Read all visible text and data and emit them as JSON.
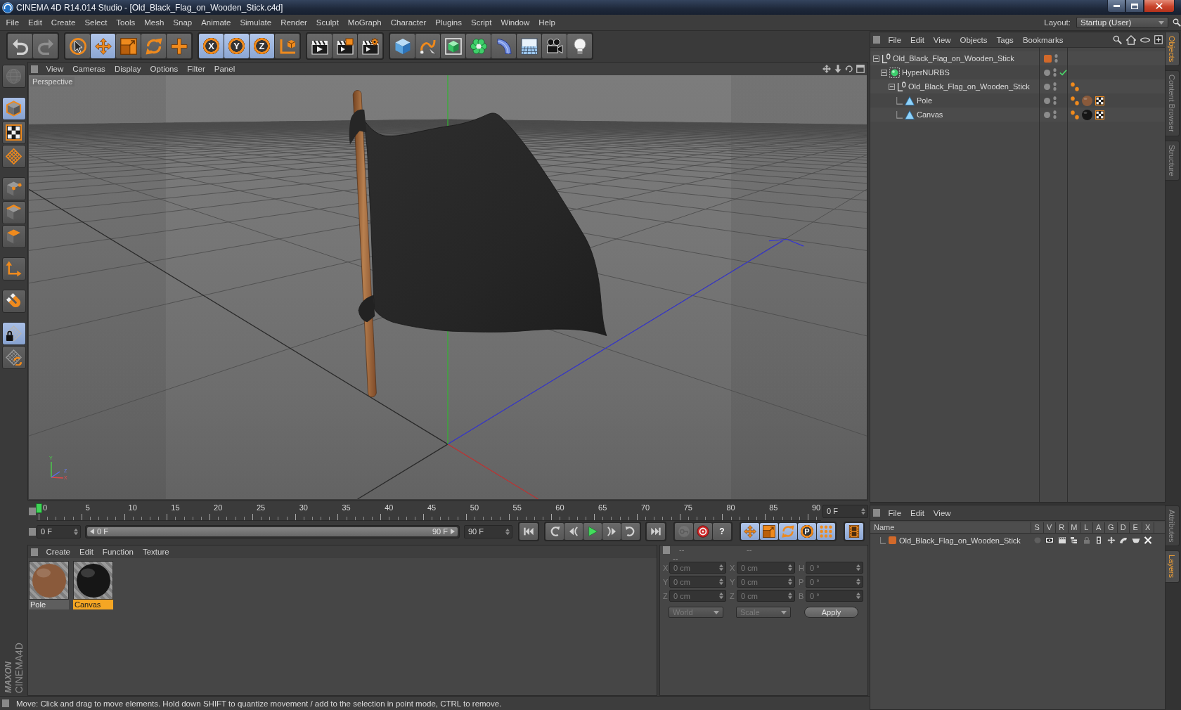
{
  "window": {
    "title": "CINEMA 4D R14.014 Studio - [Old_Black_Flag_on_Wooden_Stick.c4d]"
  },
  "menu": [
    "File",
    "Edit",
    "Create",
    "Select",
    "Tools",
    "Mesh",
    "Snap",
    "Animate",
    "Simulate",
    "Render",
    "Sculpt",
    "MoGraph",
    "Character",
    "Plugins",
    "Script",
    "Window",
    "Help"
  ],
  "layout": {
    "label": "Layout:",
    "value": "Startup (User)"
  },
  "toolbar": [
    {
      "items": [
        {
          "kind": "undo",
          "disabled": false
        },
        {
          "kind": "redo",
          "disabled": true
        }
      ]
    },
    {
      "items": [
        {
          "kind": "select",
          "selected": false
        },
        {
          "kind": "move",
          "selected": true
        },
        {
          "kind": "scale",
          "selected": false
        },
        {
          "kind": "rotate",
          "selected": false
        },
        {
          "kind": "recent",
          "selected": false
        }
      ]
    },
    {
      "items": [
        {
          "kind": "axis",
          "label": "X",
          "selected": true
        },
        {
          "kind": "axis",
          "label": "Y",
          "selected": true
        },
        {
          "kind": "axis",
          "label": "Z",
          "selected": true
        },
        {
          "kind": "coords",
          "selected": false
        }
      ]
    },
    {
      "items": [
        {
          "kind": "renderview"
        },
        {
          "kind": "renderpicture"
        },
        {
          "kind": "rendersettings"
        }
      ]
    },
    {
      "items": [
        {
          "kind": "cube"
        },
        {
          "kind": "pen"
        },
        {
          "kind": "subdivision"
        },
        {
          "kind": "cloner"
        },
        {
          "kind": "deformer"
        },
        {
          "kind": "floor"
        },
        {
          "kind": "camera"
        },
        {
          "kind": "light"
        }
      ]
    }
  ],
  "modes": [
    {
      "items": [
        {
          "kind": "editable",
          "selected": false,
          "disabled": true
        }
      ]
    },
    {
      "items": [
        {
          "kind": "model",
          "selected": true,
          "disabled": false
        },
        {
          "kind": "texture",
          "selected": false,
          "disabled": false
        },
        {
          "kind": "workplane",
          "selected": false,
          "disabled": false
        }
      ]
    },
    {
      "items": [
        {
          "kind": "points",
          "selected": false,
          "disabled": false
        },
        {
          "kind": "edges",
          "selected": false,
          "disabled": false
        },
        {
          "kind": "polygons",
          "selected": false,
          "disabled": false
        }
      ]
    },
    {
      "items": [
        {
          "kind": "objectaxis",
          "selected": false,
          "disabled": false
        }
      ]
    },
    {
      "items": [
        {
          "kind": "snap",
          "selected": false,
          "disabled": false
        }
      ]
    },
    {
      "items": [
        {
          "kind": "lockplane",
          "selected": true,
          "disabled": false
        },
        {
          "kind": "planeupdate",
          "selected": false,
          "disabled": false
        }
      ]
    }
  ],
  "logo": {
    "brand": "MAXON",
    "product": "CINEMA4D"
  },
  "viewport": {
    "menu": [
      "View",
      "Cameras",
      "Display",
      "Options",
      "Filter",
      "Panel"
    ],
    "camera": "Perspective",
    "axes": [
      "Y",
      "Z",
      "X"
    ]
  },
  "timeline": {
    "labels": [
      "0",
      "5",
      "10",
      "15",
      "20",
      "25",
      "30",
      "35",
      "40",
      "45",
      "50",
      "55",
      "60",
      "65",
      "70",
      "75",
      "80",
      "85",
      "90"
    ],
    "level": 0,
    "frame": "0 F"
  },
  "transport": {
    "start": "0 F",
    "range": {
      "start": "0 F",
      "end": "90 F",
      "level": 1
    },
    "end": "90 F",
    "playback": [
      [
        {
          "kind": "first"
        }
      ],
      [
        {
          "kind": "prevkey"
        },
        {
          "kind": "prevframe"
        },
        {
          "kind": "play"
        },
        {
          "kind": "nextframe"
        },
        {
          "kind": "nextkey"
        }
      ],
      [
        {
          "kind": "last"
        }
      ]
    ],
    "record": [
      {
        "kind": "keyframe",
        "disabled": true
      },
      {
        "kind": "autokey",
        "disabled": false
      },
      {
        "kind": "keyselect",
        "label": "?",
        "disabled": false
      }
    ],
    "tracks": [
      {
        "kind": "move",
        "selected": true
      },
      {
        "kind": "scale",
        "selected": true
      },
      {
        "kind": "rotate",
        "selected": true
      },
      {
        "kind": "param",
        "label": "P",
        "selected": true
      },
      {
        "kind": "points",
        "selected": true
      }
    ],
    "film": {
      "kind": "film",
      "selected": true
    }
  },
  "materials": {
    "menu": [
      "Create",
      "Edit",
      "Function",
      "Texture"
    ],
    "items": [
      {
        "name": "Pole",
        "color": "#8a5a3b",
        "selected": false
      },
      {
        "name": "Canvas",
        "color": "#161616",
        "selected": true
      }
    ]
  },
  "coordinates": {
    "disabled": true,
    "headers": [
      "--",
      "--",
      "--"
    ],
    "rows": [
      [
        {
          "label": "X",
          "value": "0 cm"
        },
        {
          "label": "X",
          "value": "0 cm"
        },
        {
          "label": "H",
          "value": "0 °"
        }
      ],
      [
        {
          "label": "Y",
          "value": "0 cm"
        },
        {
          "label": "Y",
          "value": "0 cm"
        },
        {
          "label": "P",
          "value": "0 °"
        }
      ],
      [
        {
          "label": "Z",
          "value": "0 cm"
        },
        {
          "label": "Z",
          "value": "0 cm"
        },
        {
          "label": "B",
          "value": "0 °"
        }
      ]
    ],
    "modes": [
      "World",
      "Scale"
    ],
    "apply": "Apply"
  },
  "objects": {
    "menu": [
      "File",
      "Edit",
      "View",
      "Objects",
      "Tags",
      "Bookmarks"
    ],
    "tree": [
      {
        "name": "Old_Black_Flag_on_Wooden_Stick",
        "kind": "null",
        "color": "#d2692a",
        "selected": false,
        "expanded": true,
        "children": [
          {
            "name": "HyperNURBS",
            "kind": "generator",
            "enabled": true,
            "selected": false,
            "expanded": true,
            "children": [
              {
                "name": "Old_Black_Flag_on_Wooden_Stick",
                "kind": "null",
                "selected": false,
                "expanded": true,
                "tags": [
                  {
                    "kind": "phong"
                  }
                ],
                "children": [
                  {
                    "name": "Pole",
                    "kind": "polygon",
                    "selected": false,
                    "tags": [
                      {
                        "kind": "phong"
                      },
                      {
                        "kind": "material",
                        "color": "#8a5a3b"
                      },
                      {
                        "kind": "uvw"
                      }
                    ]
                  },
                  {
                    "name": "Canvas",
                    "kind": "polygon",
                    "selected": false,
                    "tags": [
                      {
                        "kind": "phong"
                      },
                      {
                        "kind": "material",
                        "color": "#161616"
                      },
                      {
                        "kind": "uvw"
                      }
                    ]
                  }
                ]
              }
            ]
          }
        ]
      }
    ]
  },
  "layers": {
    "menu": [
      "File",
      "Edit",
      "View"
    ],
    "columns": [
      "Name",
      "S",
      "V",
      "R",
      "M",
      "L",
      "A",
      "G",
      "D",
      "E",
      "X"
    ],
    "rows": [
      {
        "name": "Old_Black_Flag_on_Wooden_Stick",
        "color": "#d2692a",
        "selected": false,
        "flags": [
          false,
          true,
          true,
          true,
          false,
          true,
          true,
          true,
          true,
          true
        ]
      }
    ]
  },
  "side_tabs": {
    "upper": [
      {
        "label": "Objects",
        "selected": true
      },
      {
        "label": "Content Browser",
        "selected": false
      },
      {
        "label": "Structure",
        "selected": false
      }
    ],
    "lower": [
      {
        "label": "Attributes",
        "selected": false
      },
      {
        "label": "Layers",
        "selected": true
      }
    ]
  },
  "status_bar": "Move: Click and drag to move elements. Hold down SHIFT to quantize movement / add to the selection in point mode, CTRL to remove."
}
